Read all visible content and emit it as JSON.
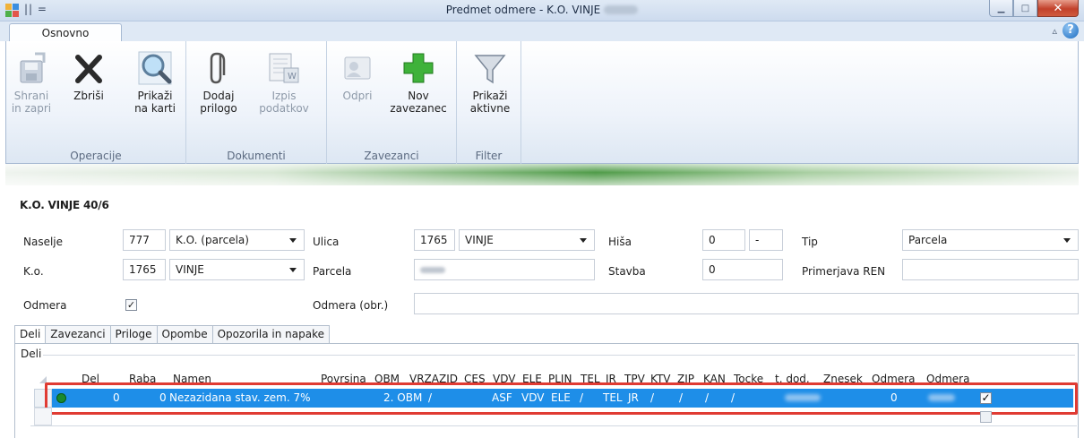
{
  "window": {
    "title": "Predmet odmere - K.O. VINJE",
    "qat": "|| ="
  },
  "ribbon": {
    "tab": "Osnovno",
    "groups": [
      {
        "label": "Operacije",
        "buttons": [
          {
            "line1": "Shrani",
            "line2": "in zapri",
            "icon": "save-icon",
            "enabled": false
          },
          {
            "line1": "Zbriši",
            "line2": "",
            "icon": "delete-x-icon",
            "enabled": true
          },
          {
            "line1": "Prikaži",
            "line2": "na karti",
            "icon": "magnifier-icon",
            "enabled": true
          }
        ]
      },
      {
        "label": "Dokumenti",
        "buttons": [
          {
            "line1": "Dodaj",
            "line2": "prilogo",
            "icon": "paperclip-icon",
            "enabled": true
          },
          {
            "line1": "Izpis",
            "line2": "podatkov",
            "icon": "print-document-icon",
            "enabled": false
          }
        ]
      },
      {
        "label": "Zavezanci",
        "buttons": [
          {
            "line1": "Odpri",
            "line2": "",
            "icon": "open-contact-icon",
            "enabled": false
          },
          {
            "line1": "Nov",
            "line2": "zavezanec",
            "icon": "green-plus-icon",
            "enabled": true
          }
        ]
      },
      {
        "label": "Filter",
        "buttons": [
          {
            "line1": "Prikaži",
            "line2": "aktivne",
            "icon": "funnel-icon",
            "enabled": true
          }
        ]
      }
    ]
  },
  "form": {
    "heading": "K.O. VINJE 40/6",
    "naselje": {
      "label": "Naselje",
      "code": "777",
      "value": "K.O. (parcela)"
    },
    "ulica": {
      "label": "Ulica",
      "code": "1765",
      "value": "VINJE"
    },
    "hisa": {
      "label": "Hiša",
      "number": "0",
      "suffix": "-"
    },
    "tip": {
      "label": "Tip",
      "value": "Parcela"
    },
    "ko": {
      "label": "K.o.",
      "code": "1765",
      "value": "VINJE"
    },
    "parcela": {
      "label": "Parcela"
    },
    "stavba": {
      "label": "Stavba",
      "value": "0"
    },
    "primerjava": {
      "label": "Primerjava REN",
      "value": ""
    },
    "odmera": {
      "label": "Odmera",
      "checked": true
    },
    "odmera_obr": {
      "label": "Odmera (obr.)",
      "value": ""
    }
  },
  "tabs": [
    "Deli",
    "Zavezanci",
    "Priloge",
    "Opombe",
    "Opozorila in napake"
  ],
  "grid": {
    "caption": "Deli",
    "columns": [
      "Del",
      "Raba",
      "Namen",
      "Povrsina",
      "OBM",
      "VRZAZID",
      "CES",
      "VDV",
      "ELE",
      "PLIN",
      "TEL",
      "JR",
      "TPV",
      "KTV",
      "ZJP",
      "KAN",
      "Tocke",
      "t. dod.",
      "Znesek",
      "Odmera",
      "Odmera"
    ],
    "row": {
      "del": "0",
      "raba": "0",
      "namen": "Nezazidana stav. zem. 7%",
      "obm": "2. OBM",
      "vrzazid": "/",
      "ces": "ASF",
      "vdv": "VDV",
      "ele": "ELE",
      "plin": "/",
      "tel": "TEL",
      "jr": "JR",
      "tpv": "/",
      "ktv": "/",
      "zjp": "/",
      "kan": "/",
      "t_dod": "0",
      "odmera_checked": true
    }
  },
  "colors": {
    "selection": "#1e8ee8",
    "highlight": "#e03b33",
    "status": "#1a8a2e"
  }
}
